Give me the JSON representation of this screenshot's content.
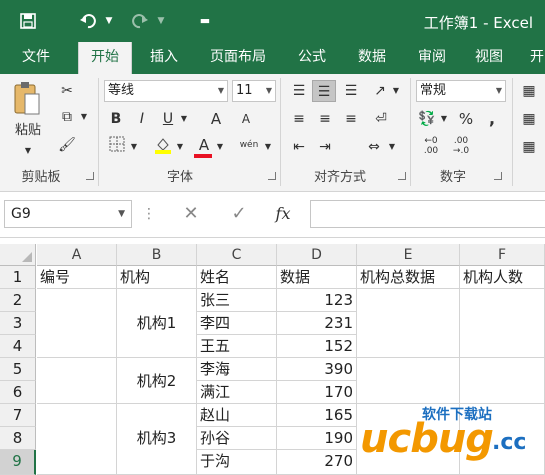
{
  "window": {
    "title": "工作簿1 - Excel"
  },
  "quick_access": {
    "save_icon": "save-icon",
    "undo_icon": "undo-icon",
    "redo_icon": "redo-icon",
    "customize_icon": "customize-icon"
  },
  "tabs": [
    {
      "label": "文件"
    },
    {
      "label": "开始"
    },
    {
      "label": "插入"
    },
    {
      "label": "页面布局"
    },
    {
      "label": "公式"
    },
    {
      "label": "数据"
    },
    {
      "label": "审阅"
    },
    {
      "label": "视图"
    },
    {
      "label": "开"
    }
  ],
  "ribbon": {
    "clipboard": {
      "label": "剪贴板",
      "paste_label": "粘贴"
    },
    "font": {
      "label": "字体",
      "font_name": "等线",
      "font_size": "11",
      "bold": "B",
      "italic": "I",
      "underline": "U",
      "grow": "A",
      "shrink": "A",
      "color_letter": "A",
      "phonetic": "wén"
    },
    "alignment": {
      "label": "对齐方式"
    },
    "number": {
      "label": "数字",
      "format": "常规",
      "percent": "%",
      "comma": ","
    }
  },
  "formula_bar": {
    "name_box": "G9",
    "fx": "fx",
    "value": ""
  },
  "grid": {
    "columns": [
      "A",
      "B",
      "C",
      "D",
      "E",
      "F"
    ],
    "rows": [
      "1",
      "2",
      "3",
      "4",
      "5",
      "6",
      "7",
      "8",
      "9"
    ],
    "selected_row": "9",
    "headers": [
      "编号",
      "机构",
      "姓名",
      "数据",
      "机构总数据",
      "机构人数"
    ],
    "org_groups": [
      "机构1",
      "机构2",
      "机构3"
    ],
    "names": [
      "张三",
      "李四",
      "王五",
      "李海",
      "满江",
      "赵山",
      "孙谷",
      "于沟"
    ],
    "values": [
      "123",
      "231",
      "152",
      "390",
      "170",
      "165",
      "190",
      "270"
    ]
  },
  "watermark": {
    "brand": "ucbug",
    "suffix": ".cc",
    "cn": "软件下载站"
  },
  "colors": {
    "excel_green": "#217346",
    "selected_header": "#217346",
    "watermark_orange": "#f39800",
    "watermark_blue": "#1c6fc0"
  }
}
